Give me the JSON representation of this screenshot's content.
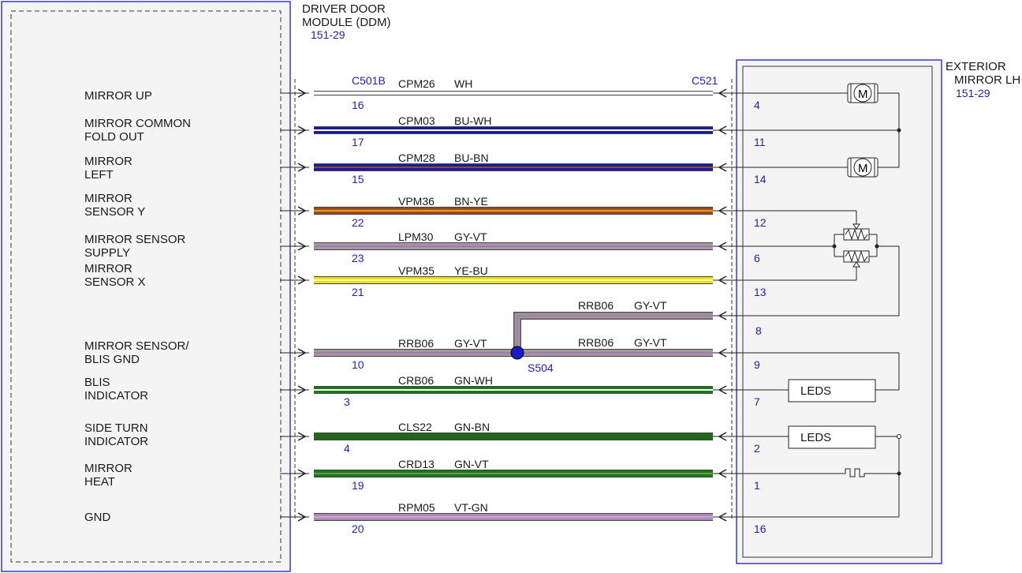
{
  "ddm": {
    "title_line1": "DRIVER DOOR",
    "title_line2": "MODULE (DDM)",
    "ref": "151-29",
    "connector": "C501B"
  },
  "mirror": {
    "title_line1": "EXTERIOR",
    "title_line2": "MIRROR LH",
    "ref": "151-29",
    "connector": "C521"
  },
  "splice": {
    "label": "S504"
  },
  "colors": {
    "WH": "#ffffff",
    "BU": "#1a1aa8",
    "BN": "#9a4a1a",
    "YE": "#e8e020",
    "GY": "#a09aa0",
    "VT": "#a878b0",
    "GN": "#1a7a1a",
    "frame": "#3a3acc"
  },
  "signals": [
    {
      "label": [
        "MIRROR UP"
      ]
    },
    {
      "label": [
        "MIRROR COMMON",
        "FOLD OUT"
      ]
    },
    {
      "label": [
        "MIRROR",
        "LEFT"
      ]
    },
    {
      "label": [
        "MIRROR",
        "SENSOR Y"
      ]
    },
    {
      "label": [
        "MIRROR SENSOR",
        "SUPPLY"
      ]
    },
    {
      "label": [
        "MIRROR",
        "SENSOR X"
      ]
    },
    {
      "label": [
        "MIRROR SENSOR/",
        "BLIS GND"
      ]
    },
    {
      "label": [
        "BLIS",
        "INDICATOR"
      ]
    },
    {
      "label": [
        "SIDE TURN",
        "INDICATOR"
      ]
    },
    {
      "label": [
        "MIRROR",
        "HEAT"
      ]
    },
    {
      "label": [
        "GND"
      ]
    }
  ],
  "wires": [
    {
      "circuit": "CPM26",
      "color": "WH",
      "ddm_pin": "16",
      "mirror_pin": "4",
      "base": "#ffffff",
      "stripe": "#ffffff"
    },
    {
      "circuit": "CPM03",
      "color": "BU-WH",
      "ddm_pin": "17",
      "mirror_pin": "11",
      "base": "#1a1aa8",
      "stripe": "#ffffff"
    },
    {
      "circuit": "CPM28",
      "color": "BU-BN",
      "ddm_pin": "15",
      "mirror_pin": "14",
      "base": "#1a1aa8",
      "stripe": "#9a4a1a"
    },
    {
      "circuit": "VPM36",
      "color": "BN-YE",
      "ddm_pin": "22",
      "mirror_pin": "12",
      "base": "#9a4a1a",
      "stripe": "#e8a020"
    },
    {
      "circuit": "LPM30",
      "color": "GY-VT",
      "ddm_pin": "23",
      "mirror_pin": "6",
      "base": "#a09aa0",
      "stripe": "#a878b0"
    },
    {
      "circuit": "VPM35",
      "color": "YE-BU",
      "ddm_pin": "21",
      "mirror_pin": "13",
      "base": "#e8e020",
      "stripe": "#ffffa0"
    },
    {
      "circuit": "RRB06",
      "color": "GY-VT",
      "ddm_pin": "10",
      "mirror_pin": "9",
      "base": "#a09aa0",
      "stripe": "#a878b0"
    },
    {
      "circuit": "CRB06",
      "color": "GN-WH",
      "ddm_pin": "3",
      "mirror_pin": "7",
      "base": "#1a7a1a",
      "stripe": "#ffffff"
    },
    {
      "circuit": "CLS22",
      "color": "GN-BN",
      "ddm_pin": "4",
      "mirror_pin": "2",
      "base": "#1a6a1a",
      "stripe": "#3a5a1a"
    },
    {
      "circuit": "CRD13",
      "color": "GN-VT",
      "ddm_pin": "19",
      "mirror_pin": "1",
      "base": "#1a7a1a",
      "stripe": "#6a9a4a"
    },
    {
      "circuit": "RPM05",
      "color": "VT-GN",
      "ddm_pin": "20",
      "mirror_pin": "16",
      "base": "#b088b8",
      "stripe": "#c8a8d0"
    }
  ],
  "branch": {
    "circuit": "RRB06",
    "color": "GY-VT",
    "mirror_pin": "8"
  },
  "splice_right": {
    "circuit": "RRB06",
    "color": "GY-VT"
  },
  "components": {
    "motor_label": "M",
    "leds_label": "LEDS"
  }
}
